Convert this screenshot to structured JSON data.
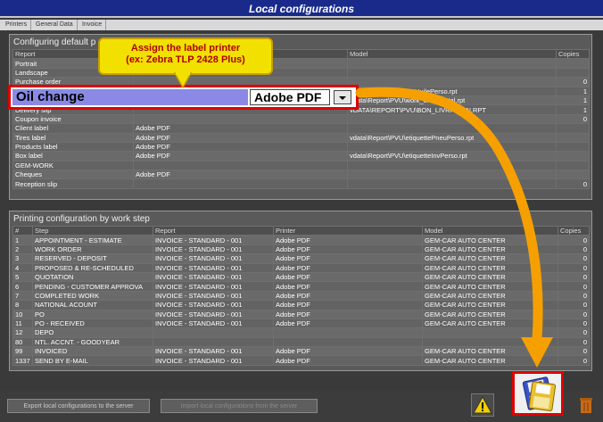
{
  "window": {
    "title": "Local configurations"
  },
  "tabs": [
    "Printers",
    "General Data",
    "Invoice"
  ],
  "defaults_panel": {
    "title": "Configuring default p",
    "columns": [
      "Report",
      "",
      "Model",
      "Copies"
    ],
    "rows": [
      [
        "Portrait",
        "",
        "",
        ""
      ],
      [
        "Landscape",
        "",
        "",
        ""
      ],
      [
        "Purchase order",
        "",
        "",
        "0"
      ],
      [
        "",
        "",
        "\\Report\\PVU\\etiquetteHuilePerso.rpt",
        "1"
      ],
      [
        "",
        "",
        "vdata\\Report\\PVU\\work_order_total.rpt",
        "1"
      ],
      [
        "Delivery slip",
        "",
        "vDATA\\REPORT\\PVU\\BON_LIVRAISON.RPT",
        "1"
      ],
      [
        "Coupon invoice",
        "",
        "",
        "0"
      ],
      [
        "Client label",
        "Adobe PDF",
        "",
        ""
      ],
      [
        "Tires label",
        "Adobe PDF",
        "vdata\\Report\\PVU\\etiquettePneuPerso.rpt",
        ""
      ],
      [
        "Products label",
        "Adobe PDF",
        "",
        ""
      ],
      [
        "Box label",
        "Adobe PDF",
        "vdata\\Report\\PVU\\etiquetteInvPerso.rpt",
        ""
      ],
      [
        "GEM-WORK",
        "",
        "",
        ""
      ],
      [
        "Cheques",
        "Adobe PDF",
        "",
        ""
      ],
      [
        "Reception slip",
        "",
        "",
        "0"
      ]
    ]
  },
  "highlight": {
    "field_value": "Oil change",
    "printer_value": "Adobe PDF"
  },
  "callout": {
    "line1": "Assign the label printer",
    "line2": "(ex: Zebra TLP 2428 Plus)"
  },
  "workstep_panel": {
    "title": "Printing configuration by work step",
    "columns": [
      "#",
      "Step",
      "Report",
      "Printer",
      "Model",
      "Copies"
    ],
    "rows": [
      [
        "1",
        "APPOINTMENT - ESTIMATE",
        "INVOICE - STANDARD - 001",
        "Adobe PDF",
        "GEM-CAR AUTO CENTER",
        "0"
      ],
      [
        "2",
        "WORK ORDER",
        "INVOICE - STANDARD - 001",
        "Adobe PDF",
        "GEM-CAR AUTO CENTER",
        "0"
      ],
      [
        "3",
        "RESERVED - DEPOSIT",
        "INVOICE - STANDARD - 001",
        "Adobe PDF",
        "GEM-CAR AUTO CENTER",
        "0"
      ],
      [
        "4",
        "PROPOSED & RE-SCHEDULED",
        "INVOICE - STANDARD - 001",
        "Adobe PDF",
        "GEM-CAR AUTO CENTER",
        "0"
      ],
      [
        "5",
        "QUOTATION",
        "INVOICE - STANDARD - 001",
        "Adobe PDF",
        "GEM-CAR AUTO CENTER",
        "0"
      ],
      [
        "6",
        "PENDING - CUSTOMER APPROVA",
        "INVOICE - STANDARD - 001",
        "Adobe PDF",
        "GEM-CAR AUTO CENTER",
        "0"
      ],
      [
        "7",
        "COMPLETED WORK",
        "INVOICE - STANDARD - 001",
        "Adobe PDF",
        "GEM-CAR AUTO CENTER",
        "0"
      ],
      [
        "8",
        "NATIONAL ACOUNT",
        "INVOICE - STANDARD - 001",
        "Adobe PDF",
        "GEM-CAR AUTO CENTER",
        "0"
      ],
      [
        "10",
        "PO",
        "INVOICE - STANDARD - 001",
        "Adobe PDF",
        "GEM-CAR AUTO CENTER",
        "0"
      ],
      [
        "11",
        "PO - RECEIVED",
        "INVOICE - STANDARD - 001",
        "Adobe PDF",
        "GEM-CAR AUTO CENTER",
        "0"
      ],
      [
        "12",
        "DEPO",
        "",
        "",
        "",
        "0"
      ],
      [
        "80",
        "NTL. ACCNT. - GOODYEAR",
        "",
        "",
        "",
        "0"
      ],
      [
        "99",
        "INVOICED",
        "INVOICE - STANDARD - 001",
        "Adobe PDF",
        "GEM-CAR AUTO CENTER",
        "0"
      ],
      [
        "1337",
        "SEND BY E-MAIL",
        "INVOICE - STANDARD - 001",
        "Adobe PDF",
        "GEM-CAR AUTO CENTER",
        "0"
      ]
    ]
  },
  "bottom": {
    "export_label": "Export local configurations to the server",
    "import_label": "Import local configurations from the server"
  },
  "colors": {
    "accent_red": "#e00000",
    "callout_yellow": "#f2e100",
    "arrow_orange": "#f5a000",
    "titlebar_blue": "#1a2a8a"
  },
  "icons": [
    "floppy-save-icon",
    "warning-icon",
    "trash-icon",
    "dropdown-arrow-icon"
  ]
}
